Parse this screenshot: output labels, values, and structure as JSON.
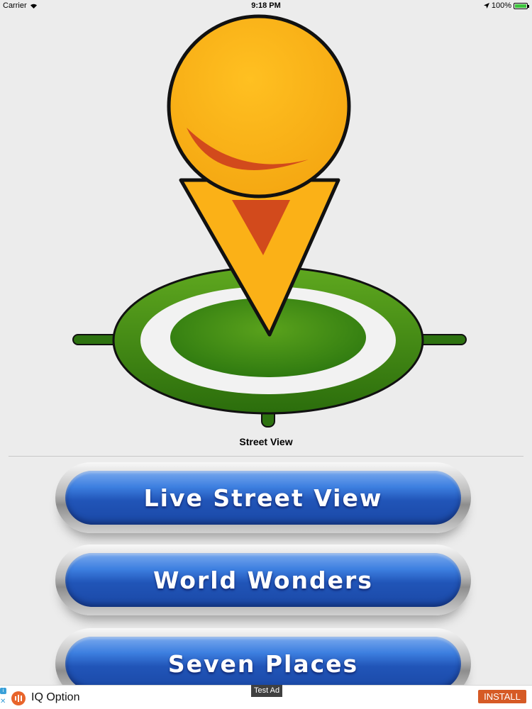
{
  "status_bar": {
    "carrier": "Carrier",
    "time": "9:18 PM",
    "battery": "100%",
    "icons": [
      "wifi-icon",
      "location-arrow-icon",
      "battery-icon"
    ]
  },
  "logo": {
    "description_icon": "map-pin-target-icon",
    "colors": {
      "pin": "#fbb117",
      "pin_accent": "#d24a1c",
      "target_dark": "#2e7a10",
      "target_light": "#5fa81f"
    }
  },
  "subtitle": "Street View",
  "menu": {
    "items": [
      {
        "label": "Live Street View"
      },
      {
        "label": "World Wonders"
      },
      {
        "label": "Seven Places"
      }
    ],
    "colors": {
      "button_blue": "#2155b8",
      "button_silver": "#b8b8b8"
    }
  },
  "ad": {
    "badge": "Test Ad",
    "app_name": "IQ Option",
    "install_label": "INSTALL",
    "info_glyph": "i",
    "close_glyph": "✕",
    "colors": {
      "install": "#d65a25",
      "logo": "#e8642a"
    }
  }
}
